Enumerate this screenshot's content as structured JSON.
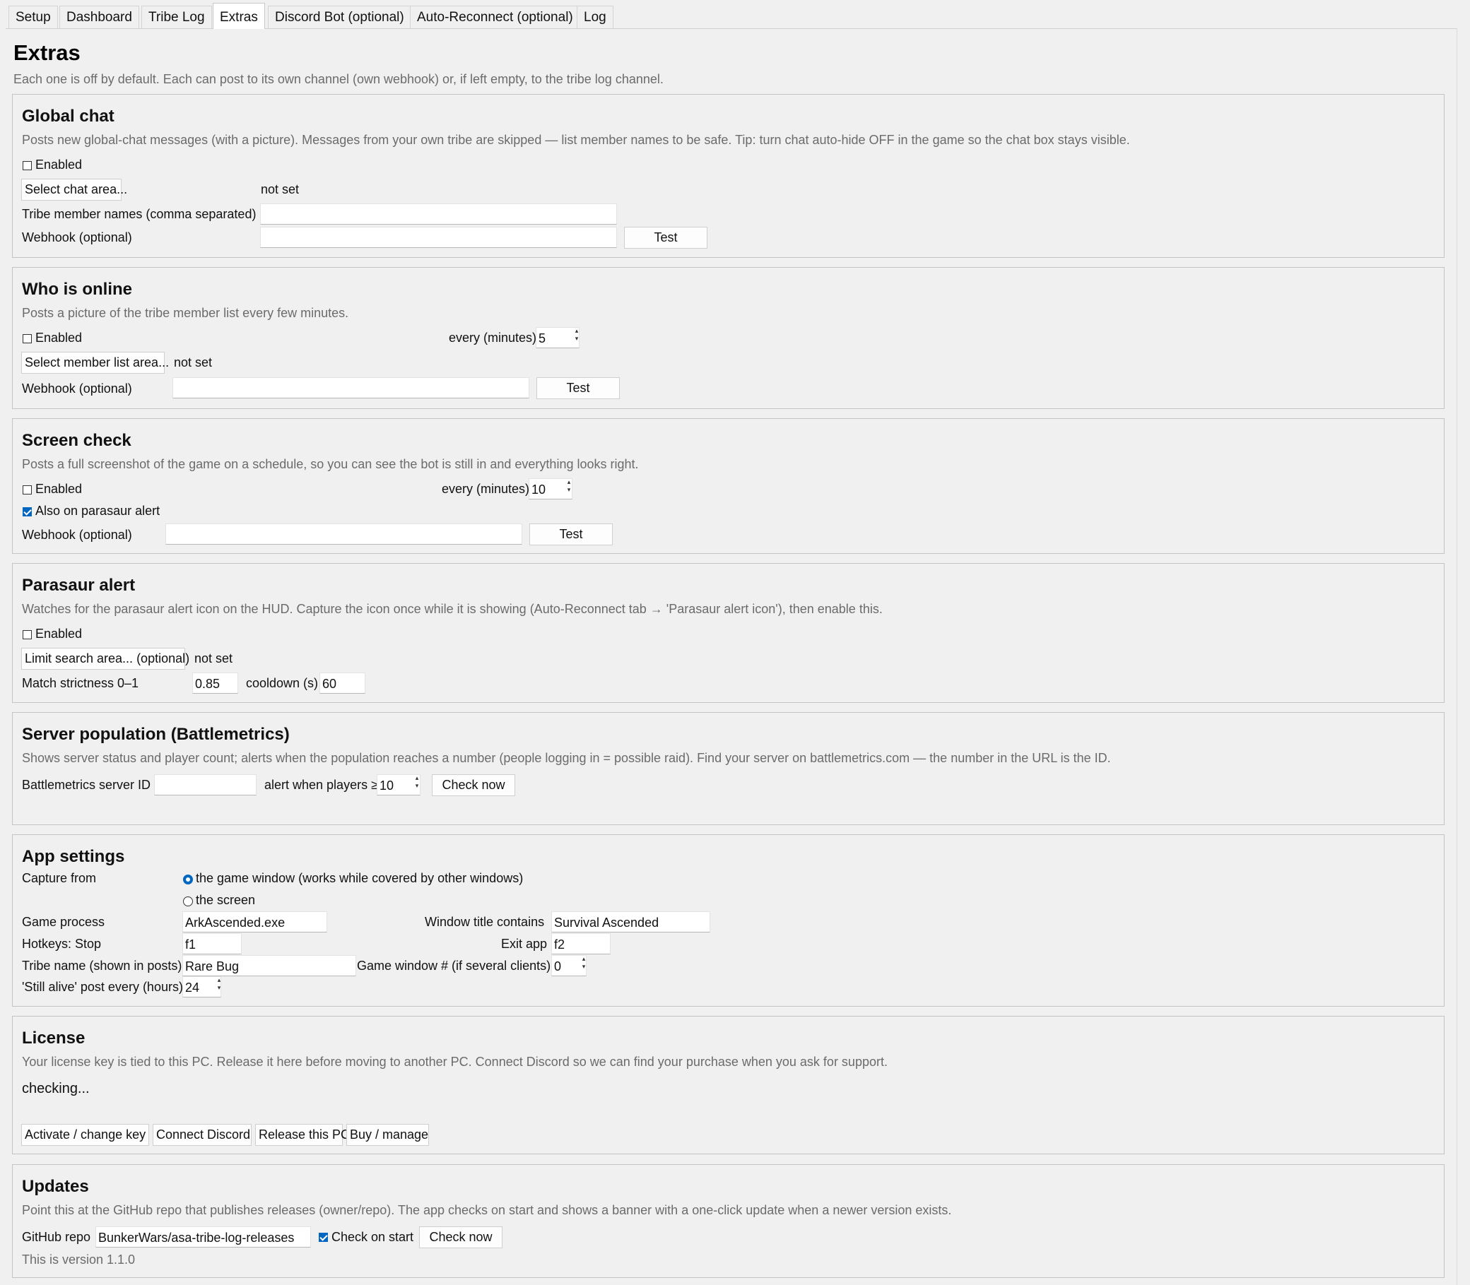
{
  "tabs": [
    "Setup",
    "Dashboard",
    "Tribe Log",
    "Extras",
    "Discord Bot (optional)",
    "Auto-Reconnect (optional)",
    "Log"
  ],
  "header": {
    "title": "Extras",
    "desc": "Each one is off by default. Each can post to its own channel (own webhook) or, if left empty, to the tribe log channel."
  },
  "global_chat": {
    "title": "Global chat",
    "desc": "Posts new global-chat messages (with a picture). Messages from your own tribe are skipped — list member names to be safe. Tip: turn chat auto-hide OFF in the game so the chat box stays visible.",
    "enabled_label": "Enabled",
    "select_button": "Select chat area...",
    "area_status": "not set",
    "members_label": "Tribe member names (comma separated)",
    "members_value": "",
    "webhook_label": "Webhook (optional)",
    "webhook_value": "",
    "test_button": "Test"
  },
  "who_online": {
    "title": "Who is online",
    "desc": "Posts a picture of the tribe member list every few minutes.",
    "enabled_label": "Enabled",
    "every_label": "every (minutes)",
    "every_value": "5",
    "select_button": "Select member list area...",
    "area_status": "not set",
    "webhook_label": "Webhook (optional)",
    "webhook_value": "",
    "test_button": "Test"
  },
  "screen_check": {
    "title": "Screen check",
    "desc": "Posts a full screenshot of the game on a schedule, so you can see the bot is still in and everything looks right.",
    "enabled_label": "Enabled",
    "every_label": "every (minutes)",
    "every_value": "10",
    "parasaur_label": "Also on parasaur alert",
    "webhook_label": "Webhook (optional)",
    "webhook_value": "",
    "test_button": "Test"
  },
  "parasaur": {
    "title": "Parasaur alert",
    "desc": "Watches for the parasaur alert icon on the HUD. Capture the icon once while it is showing (Auto-Reconnect tab → 'Parasaur alert icon'), then enable this.",
    "enabled_label": "Enabled",
    "limit_button": "Limit search area... (optional)",
    "area_status": "not set",
    "strictness_label": "Match strictness 0–1",
    "strictness_value": "0.85",
    "cooldown_label": "cooldown (s)",
    "cooldown_value": "60"
  },
  "server_pop": {
    "title": "Server population (Battlemetrics)",
    "desc": "Shows server status and player count; alerts when the population reaches a number (people logging in = possible raid). Find your server on battlemetrics.com — the number in the URL is the ID.",
    "id_label": "Battlemetrics server ID",
    "id_value": "",
    "alert_label": "alert when players ≥",
    "alert_value": "10",
    "check_button": "Check now"
  },
  "app_settings": {
    "title": "App settings",
    "capture_label": "Capture from",
    "capture_option_game": "the game window (works while covered by other windows)",
    "capture_option_screen": "the screen",
    "process_label": "Game process",
    "process_value": "ArkAscended.exe",
    "window_title_label": "Window title contains",
    "window_title_value": "Survival Ascended",
    "hotkey_stop_label": "Hotkeys: Stop",
    "hotkey_stop_value": "f1",
    "exit_label": "Exit app",
    "exit_value": "f2",
    "tribe_name_label": "Tribe name (shown in posts)",
    "tribe_name_value": "Rare Bug",
    "game_window_label": "Game window # (if several clients)",
    "game_window_value": "0",
    "still_alive_label": "'Still alive' post every (hours)",
    "still_alive_value": "24"
  },
  "license": {
    "title": "License",
    "desc": "Your license key is tied to this PC. Release it here before moving to another PC. Connect Discord so we can find your purchase when you ask for support.",
    "status": "checking...",
    "activate_button": "Activate / change key",
    "discord_button": "Connect Discord",
    "release_button": "Release this PC",
    "buy_button": "Buy / manage"
  },
  "updates": {
    "title": "Updates",
    "desc": "Point this at the GitHub repo that publishes releases (owner/repo). The app checks on start and shows a banner with a one-click update when a newer version exists.",
    "repo_label": "GitHub repo",
    "repo_value": "BunkerWars/asa-tribe-log-releases",
    "check_start_label": "Check on start",
    "check_button": "Check now",
    "version": "This is version 1.1.0"
  },
  "colors": {
    "accent": "#0067c0",
    "background": "#f0f0f0",
    "muted_text": "#6b6b6b",
    "border": "#c3c3c3"
  }
}
